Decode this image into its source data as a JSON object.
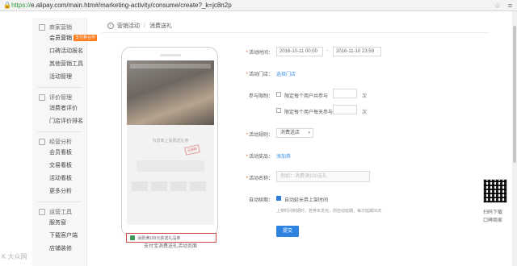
{
  "browser": {
    "url_scheme": "https://",
    "url_rest": "e.alipay.com/main.htm#/marketing-activity/consume/create?_k=jc8n2p"
  },
  "sidebar": {
    "groups": [
      {
        "title": "商家营销",
        "items": [
          {
            "label": "会员营销",
            "tag": "支付券合作"
          },
          {
            "label": "口碑活动报名"
          },
          {
            "label": "其他营销工具"
          },
          {
            "label": "活动管理"
          }
        ]
      },
      {
        "title": "评价管理",
        "items": [
          {
            "label": "消费者评价"
          },
          {
            "label": "门店评价排名"
          }
        ]
      },
      {
        "title": "经营分析",
        "items": [
          {
            "label": "会员看板"
          },
          {
            "label": "交易看板"
          },
          {
            "label": "活动看板"
          },
          {
            "label": "更多分析"
          }
        ]
      },
      {
        "title": "运营工具",
        "items": [
          {
            "label": "服务窗"
          },
          {
            "label": "下载客户端"
          },
          {
            "label": "店铺装修"
          }
        ]
      }
    ]
  },
  "breadcrumb": {
    "parent": "营销活动",
    "current": "消费送礼"
  },
  "preview": {
    "hero_title": "为您奉上消费送礼券",
    "stamp": "已领取",
    "highlight_text": "消费满100元获送礼品券",
    "caption": "支付宝消费送礼活动页面"
  },
  "form": {
    "time_label": "活动时间：",
    "start_date": "2016-10-11 00:00",
    "dash": "-",
    "end_date": "2016-11-10 23:59",
    "store_label": "活动门店：",
    "store_link": "选择门店",
    "limit_label": "参与限制：",
    "limit_opt1": "限定每个用户共参与",
    "limit_opt2": "限定每个用户每天参与",
    "unit": "次",
    "rule_label": "活动规则：",
    "rule_value": "消费送店",
    "rule_caret": "▾",
    "gift_label": "活动奖品：",
    "gift_link": "添加券",
    "name_label": "活动名称：",
    "name_placeholder": "例如：消费满100送礼",
    "auto_label": "自动续期：",
    "auto_opt": "自动延长券上架时间",
    "auto_note": "上架时间到期时，若券未发完，则自动延期，每次延期30天",
    "submit": "提交"
  },
  "right_panel": {
    "qr_line1": "扫码下载",
    "qr_line2": "口碑商家"
  },
  "watermark": "K 大众网"
}
